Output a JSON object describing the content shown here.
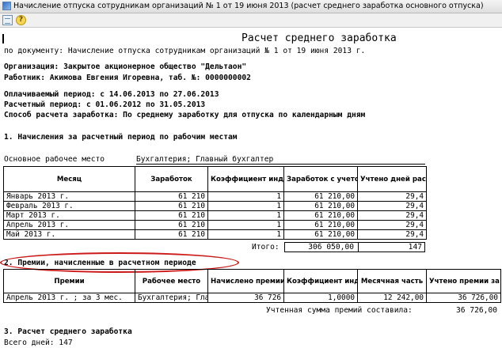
{
  "window": {
    "title": "Начисление отпуска сотрудникам организаций № 1 от 19 июня 2013 (расчет среднего заработка основного отпуска)"
  },
  "toolbar": {
    "help_glyph": "?"
  },
  "report": {
    "title": "Расчет среднего заработка",
    "document_line": "по документу: Начисление отпуска сотрудникам организаций № 1 от 19 июня 2013 г.",
    "organization": "Организация: Закрытое акционерное общество \"Дельтаон\"",
    "employee": "Работник: Акимова Евгения Игоревна, таб. №: 0000000002",
    "paid_period": "Оплачиваемый период: с 14.06.2013 по 27.06.2013",
    "calc_period": "Расчетный период: с 01.06.2012 по 31.05.2013",
    "calc_method": "Способ расчета заработка: По среднему заработку для отпуска по календарным дням"
  },
  "section1": {
    "heading": "1. Начисления за расчетный период по рабочим местам",
    "workplace_label": "Основное рабочее место",
    "workplace_value": "Бухгалтерия; Главный бухгалтер",
    "columns": [
      "Месяц",
      "Заработок",
      "Коэффициент индексации",
      "Заработок с учетом индексации",
      "Учтено дней расчетного периода"
    ],
    "rows": [
      {
        "month": "Январь 2013 г.",
        "earnings": "61 210",
        "coef": "1",
        "indexed": "61 210,00",
        "days": "29,4"
      },
      {
        "month": "Февраль 2013 г.",
        "earnings": "61 210",
        "coef": "1",
        "indexed": "61 210,00",
        "days": "29,4"
      },
      {
        "month": "Март 2013 г.",
        "earnings": "61 210",
        "coef": "1",
        "indexed": "61 210,00",
        "days": "29,4"
      },
      {
        "month": "Апрель 2013 г.",
        "earnings": "61 210",
        "coef": "1",
        "indexed": "61 210,00",
        "days": "29,4"
      },
      {
        "month": "Май 2013 г.",
        "earnings": "61 210",
        "coef": "1",
        "indexed": "61 210,00",
        "days": "29,4"
      }
    ],
    "total_label": "Итого:",
    "total_indexed": "306 050,00",
    "total_days": "147"
  },
  "section2": {
    "heading": "2. Премии, начисленные в расчетном периоде",
    "columns": [
      "Премии",
      "Рабочее место",
      "Начислено премии",
      "Коэффициент индексации",
      "Месячная часть",
      "Учтено премии за расчетный период"
    ],
    "rows": [
      {
        "premium": "Апрель 2013 г. ; за 3 мес.",
        "workplace": "Бухгалтерия; Главный бухгалтер",
        "accrued": "36 726",
        "coef": "1,0000",
        "monthly": "12 242,00",
        "counted": "36 726,00"
      }
    ],
    "summary_label": "Учтенная сумма премий составила:",
    "summary_value": "36 726,00"
  },
  "section3": {
    "heading": "3. Расчет среднего  заработка",
    "total_days": "Всего дней: 147"
  },
  "colors": {
    "annotation_red": "#cc1a1a"
  }
}
